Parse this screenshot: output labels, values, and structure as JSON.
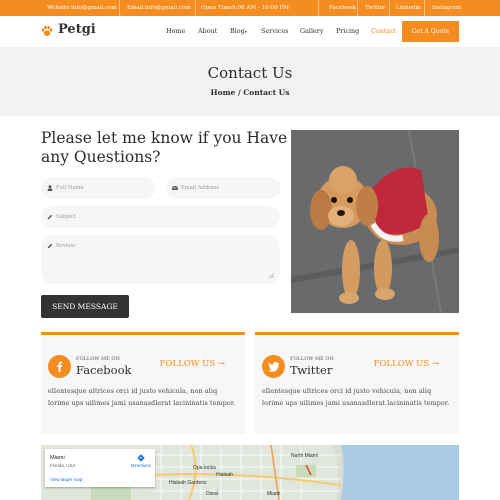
{
  "topbar": {
    "website_label": "Website :",
    "website_value": "info@gmail.com",
    "email_label": "Email :",
    "email_value": "info@gmail.com",
    "hours_label": "Open Time :",
    "hours_value": "9:00 AM - 10:00 PM",
    "social": [
      "Facebook",
      "Twitter",
      "Linkedin",
      "Instagram"
    ]
  },
  "header": {
    "logo": "Petgi",
    "nav": [
      "Home",
      "About",
      "Blog",
      "Services",
      "Gallery",
      "Pricing",
      "Contact"
    ],
    "active": "Contact",
    "quote_button": "Get A Quote"
  },
  "banner": {
    "title": "Contact Us",
    "breadcrumb": "Home / Contact Us"
  },
  "form": {
    "heading": "Please let me know if you Have any Questions?",
    "full_name_placeholder": "Full Name",
    "email_placeholder": "Email Address",
    "subject_placeholder": "Subject",
    "review_placeholder": "Review",
    "submit": "SEND MESSAGE"
  },
  "cards": [
    {
      "icon": "facebook-icon",
      "small": "FOLLOW ME ON",
      "name": "Facebook",
      "follow": "FOLLOW US →",
      "text": "ellentesque ultrices orci id justo vehicula, non aliq lorime ups uilimes jami usanasdlerat lacininatis tempor."
    },
    {
      "icon": "twitter-icon",
      "small": "FOLLOW ME ON",
      "name": "Twitter",
      "follow": "FOLLOW US →",
      "text": "ellentesque ultrices orci id justo vehicula, non aliq lorime ups uilimes jami usanasdlerat lacininatis tempor."
    }
  ],
  "map": {
    "place": "Miami",
    "region": "Florida, USA",
    "directions": "Directions",
    "larger": "View larger map",
    "labels": [
      "Hialeah",
      "Miami",
      "Doral",
      "Hialeah Gardens",
      "Opa-locka",
      "North Miami"
    ]
  },
  "colors": {
    "accent": "#f48c1f",
    "dark": "#333333",
    "light_bg": "#f2f2f2"
  }
}
